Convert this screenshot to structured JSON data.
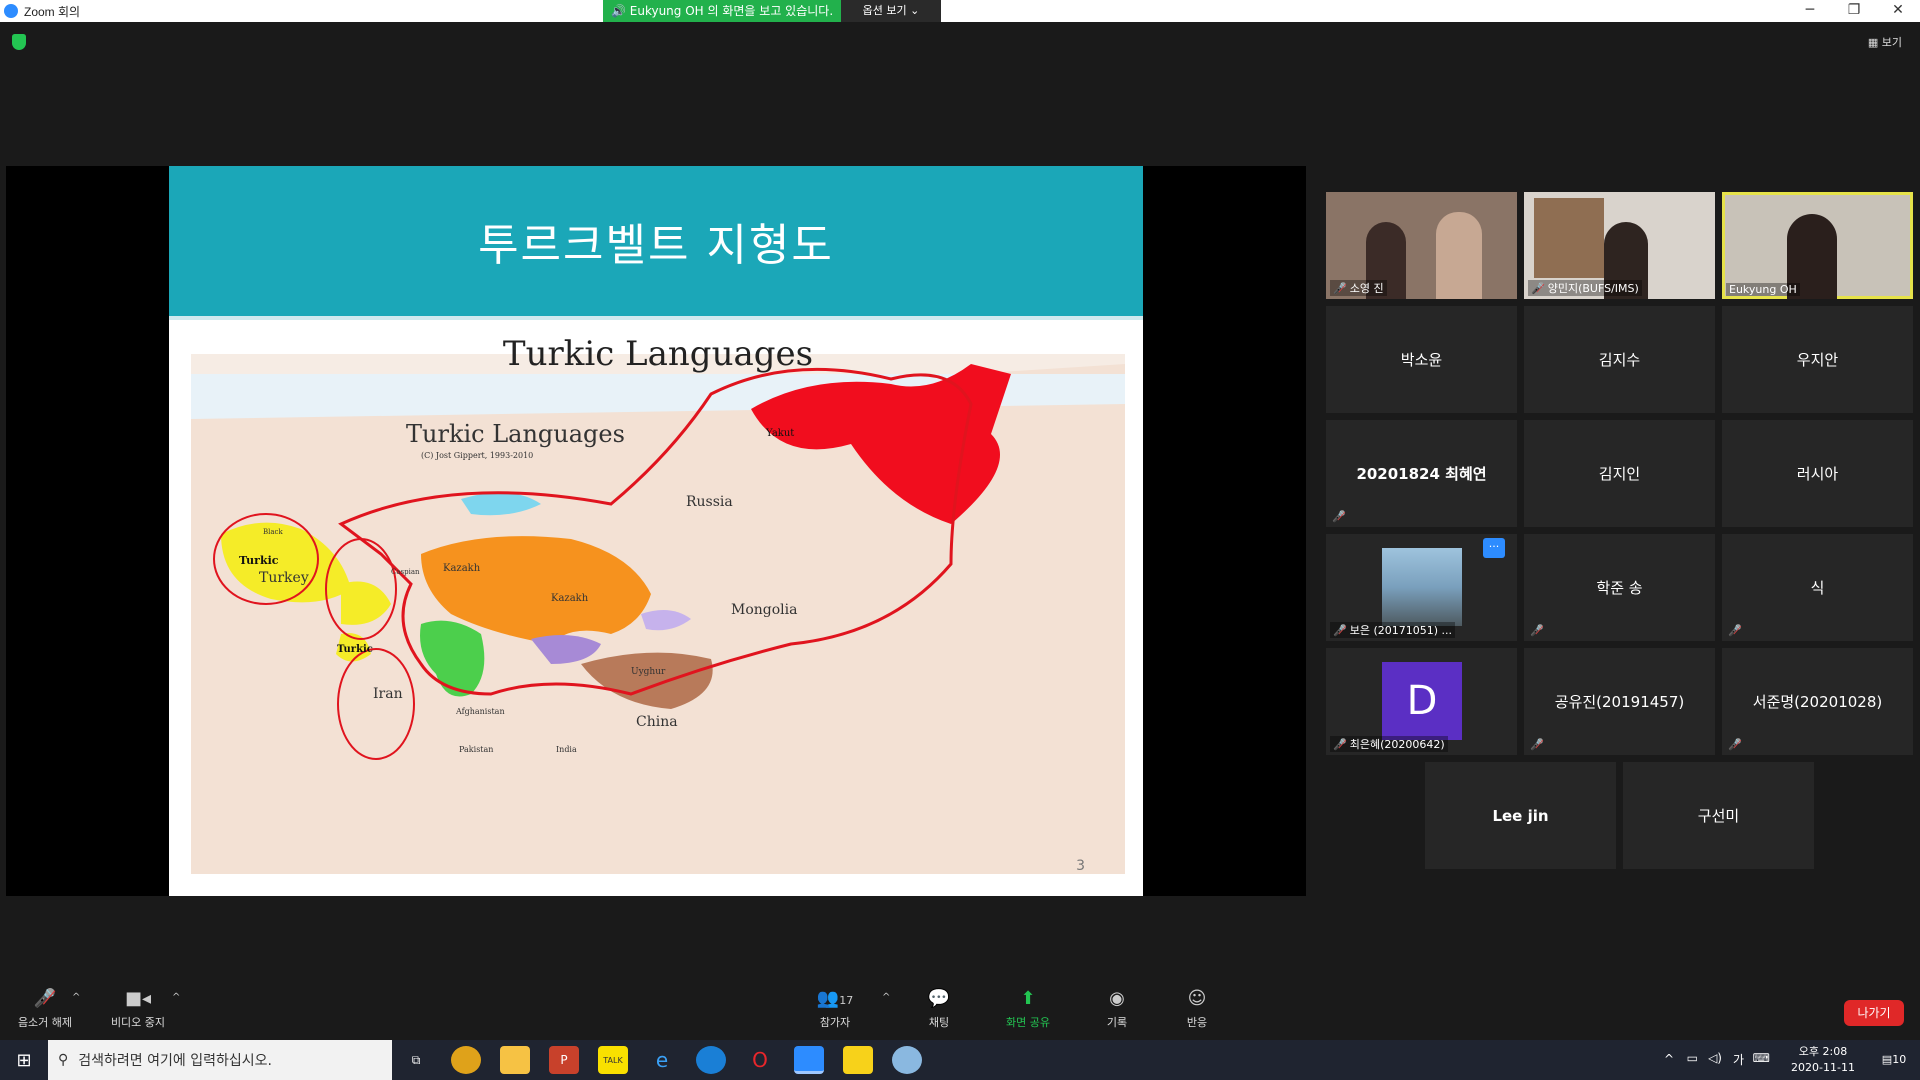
{
  "window": {
    "title": "Zoom 회의",
    "share_banner": "Eukyung OH 의 화면을 보고 있습니다.",
    "view_options": "옵션 보기",
    "minimize": "─",
    "maximize": "❐",
    "close": "✕"
  },
  "top_right": {
    "view_label": "보기"
  },
  "slide": {
    "title": "투르크벨트 지형도",
    "map_title": "Turkic Languages",
    "map_subtitle": "Turkic Languages",
    "map_copyright": "(C) Jost Gippert, 1993-2010",
    "page_number": "3",
    "map_labels": [
      "Yakut",
      "Russia",
      "Kazakh",
      "Kazakh",
      "Turkic",
      "Turkey",
      "Turkic",
      "Mongolia",
      "Uyghur",
      "China",
      "Iran",
      "Afghanistan",
      "Pakistan",
      "India",
      "Caspian",
      "Black"
    ]
  },
  "gallery": {
    "tiles": [
      {
        "name": "소영 진",
        "video": true,
        "muted": true
      },
      {
        "name": "양민지(BUFS/IMS)",
        "video": true,
        "muted": true
      },
      {
        "name": "Eukyung OH",
        "video": true,
        "muted": false,
        "active": true
      },
      {
        "name": "박소윤",
        "muted": false
      },
      {
        "name": "김지수",
        "muted": false
      },
      {
        "name": "우지안",
        "muted": false
      },
      {
        "name": "20201824 최혜연",
        "muted": true
      },
      {
        "name": "김지인",
        "muted": false
      },
      {
        "name": "러시아",
        "muted": false
      },
      {
        "name": "보은 (20171051) ...",
        "muted": true,
        "photo": true
      },
      {
        "name": "학준 송",
        "muted": true
      },
      {
        "name": "식",
        "muted": true
      },
      {
        "name": "최은혜(20200642)",
        "muted": true,
        "avatar_letter": "D"
      },
      {
        "name": "공유진(20191457)",
        "muted": true
      },
      {
        "name": "서준명(20201028)",
        "muted": true
      },
      {
        "name": "Lee jin",
        "muted": false
      },
      {
        "name": "구선미",
        "muted": false
      }
    ],
    "more_label": "···"
  },
  "toolbar": {
    "unmute": "음소거 해제",
    "stop_video": "비디오 중지",
    "participants": "참가자",
    "participants_count": "17",
    "chat": "채팅",
    "share_screen": "화면 공유",
    "record": "기록",
    "reactions": "반응",
    "leave": "나가기"
  },
  "taskbar": {
    "search_placeholder": "검색하려면 여기에 입력하십시오.",
    "time": "오후 2:08",
    "date": "2020-11-11",
    "ime": "가",
    "notification_count": "10"
  },
  "colors": {
    "share_green": "#22b14c",
    "slide_teal": "#1ba7b8",
    "active_speaker": "#e6e24a",
    "leave_red": "#e02828",
    "avatar_purple": "#5b2fc4"
  }
}
